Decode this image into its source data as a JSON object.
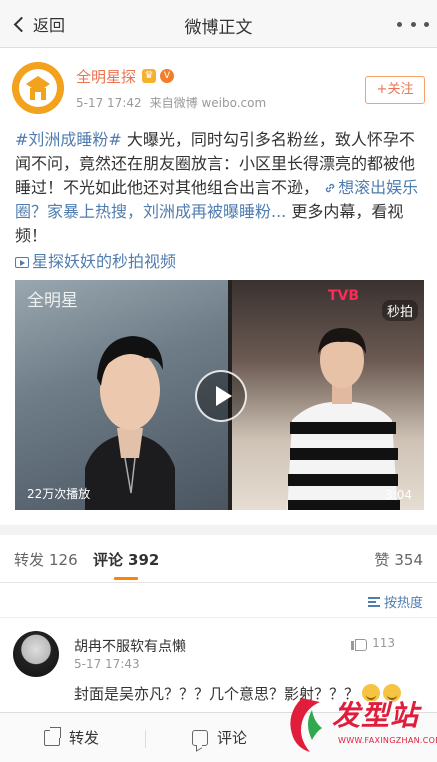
{
  "navbar": {
    "back_label": "返回",
    "title": "微博正文",
    "more_icon": "more-dots-icon"
  },
  "post": {
    "author": "全明星探",
    "time": "5-17 17:42",
    "source": "来自微博 weibo.com",
    "follow_label": "+关注",
    "topic": "#刘洲成睡粉#",
    "text_1": "大曝光，同时勾引多名粉丝，致人怀孕不闻不问，竟然还在朋友圈放言：小区里长得漂亮的都被他睡过！不光如此他还对其他组合出言不逊，",
    "link_text": "想滚出娱乐圈？家暴上热搜，刘洲成再被曝睡粉...",
    "text_2": "更多内幕，看视频！",
    "video_link": "星探妖妖的秒拍视频"
  },
  "video": {
    "watermark_left": "全明星",
    "watermark_right": "秒拍",
    "brand_tag": "TVB",
    "play_count": "22万次播放",
    "duration": "3:04"
  },
  "tabs": [
    {
      "label": "转发",
      "count": "126"
    },
    {
      "label": "评论",
      "count": "392"
    },
    {
      "label": "赞",
      "count": "354"
    }
  ],
  "sort_label": "按热度",
  "comment": {
    "name": "胡冉不服软有点懒",
    "time": "5-17 17:43",
    "likes": "113",
    "text": "封面是吴亦凡？？？几个意思？影射？？？"
  },
  "bottom_bar": {
    "repost_label": "转发",
    "comment_label": "评论"
  },
  "site_watermark": {
    "text": "发型站",
    "url": "WWW.FAXINGZHAN.COM"
  },
  "colors": {
    "accent": "#eb7350",
    "link": "#507daf",
    "tab_underline": "#ff8200",
    "watermark": "#e11d3c"
  }
}
